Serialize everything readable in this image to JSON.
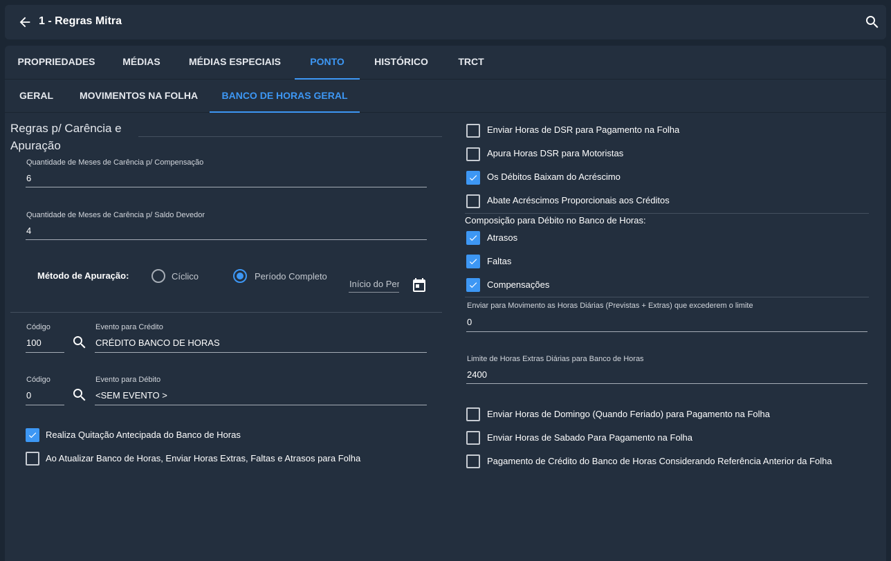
{
  "header": {
    "title": "1 - Regras Mitra"
  },
  "tabs": [
    "PROPRIEDADES",
    "MÉDIAS",
    "MÉDIAS ESPECIAIS",
    "PONTO",
    "HISTÓRICO",
    "TRCT"
  ],
  "active_tab": "PONTO",
  "subtabs": [
    "GERAL",
    "MOVIMENTOS NA FOLHA",
    "BANCO DE HORAS GERAL"
  ],
  "active_subtab": "BANCO DE HORAS GERAL",
  "left": {
    "section_title": "Regras p/ Carência e Apuração",
    "carencia_comp": {
      "label": "Quantidade de Meses de Carência p/ Compensação",
      "value": "6"
    },
    "carencia_saldo": {
      "label": "Quantidade de Meses de Carência p/ Saldo Devedor",
      "value": "4"
    },
    "metodo": {
      "label": "Método de Apuração:",
      "options": [
        "Cíclico",
        "Período Completo"
      ],
      "selected": "Período Completo"
    },
    "inicio_periodo": {
      "placeholder": "Início do Período"
    },
    "credito": {
      "codigo_label": "Código",
      "codigo": "100",
      "evento_label": "Evento para Crédito",
      "evento": "CRÉDITO BANCO DE HORAS"
    },
    "debito": {
      "codigo_label": "Código",
      "codigo": "0",
      "evento_label": "Evento para Débito",
      "evento": "<SEM EVENTO >"
    },
    "checks": [
      {
        "label": "Realiza Quitação Antecipada do Banco de Horas",
        "checked": true
      },
      {
        "label": "Ao Atualizar Banco de Horas, Enviar Horas Extras, Faltas e Atrasos para Folha",
        "checked": false
      }
    ]
  },
  "right": {
    "checks_top": [
      {
        "label": "Enviar Horas de DSR para Pagamento na Folha",
        "checked": false
      },
      {
        "label": "Apura Horas DSR para Motoristas",
        "checked": false
      },
      {
        "label": "Os Débitos Baixam do Acréscimo",
        "checked": true
      },
      {
        "label": "Abate Acréscimos Proporcionais aos Créditos",
        "checked": false
      }
    ],
    "composicao_title": "Composição para Débito no Banco de Horas:",
    "composicao": [
      {
        "label": "Atrasos",
        "checked": true
      },
      {
        "label": "Faltas",
        "checked": true
      },
      {
        "label": "Compensações",
        "checked": true
      }
    ],
    "limite_diario": {
      "label": "Enviar para Movimento as Horas Diárias (Previstas + Extras) que excederem o limite",
      "value": "0"
    },
    "limite_extras": {
      "label": "Limite de Horas Extras Diárias para Banco de Horas",
      "value": "2400"
    },
    "checks_bottom": [
      {
        "label": "Enviar Horas de Domingo (Quando Feriado) para Pagamento na Folha",
        "checked": false
      },
      {
        "label": "Enviar Horas de Sabado Para Pagamento na Folha",
        "checked": false
      },
      {
        "label": "Pagamento de Crédito do Banco de Horas Considerando Referência Anterior da Folha",
        "checked": false
      }
    ]
  },
  "colors": {
    "background": "#1b2633",
    "panel": "#232f3e",
    "accent": "#3d97f4"
  }
}
